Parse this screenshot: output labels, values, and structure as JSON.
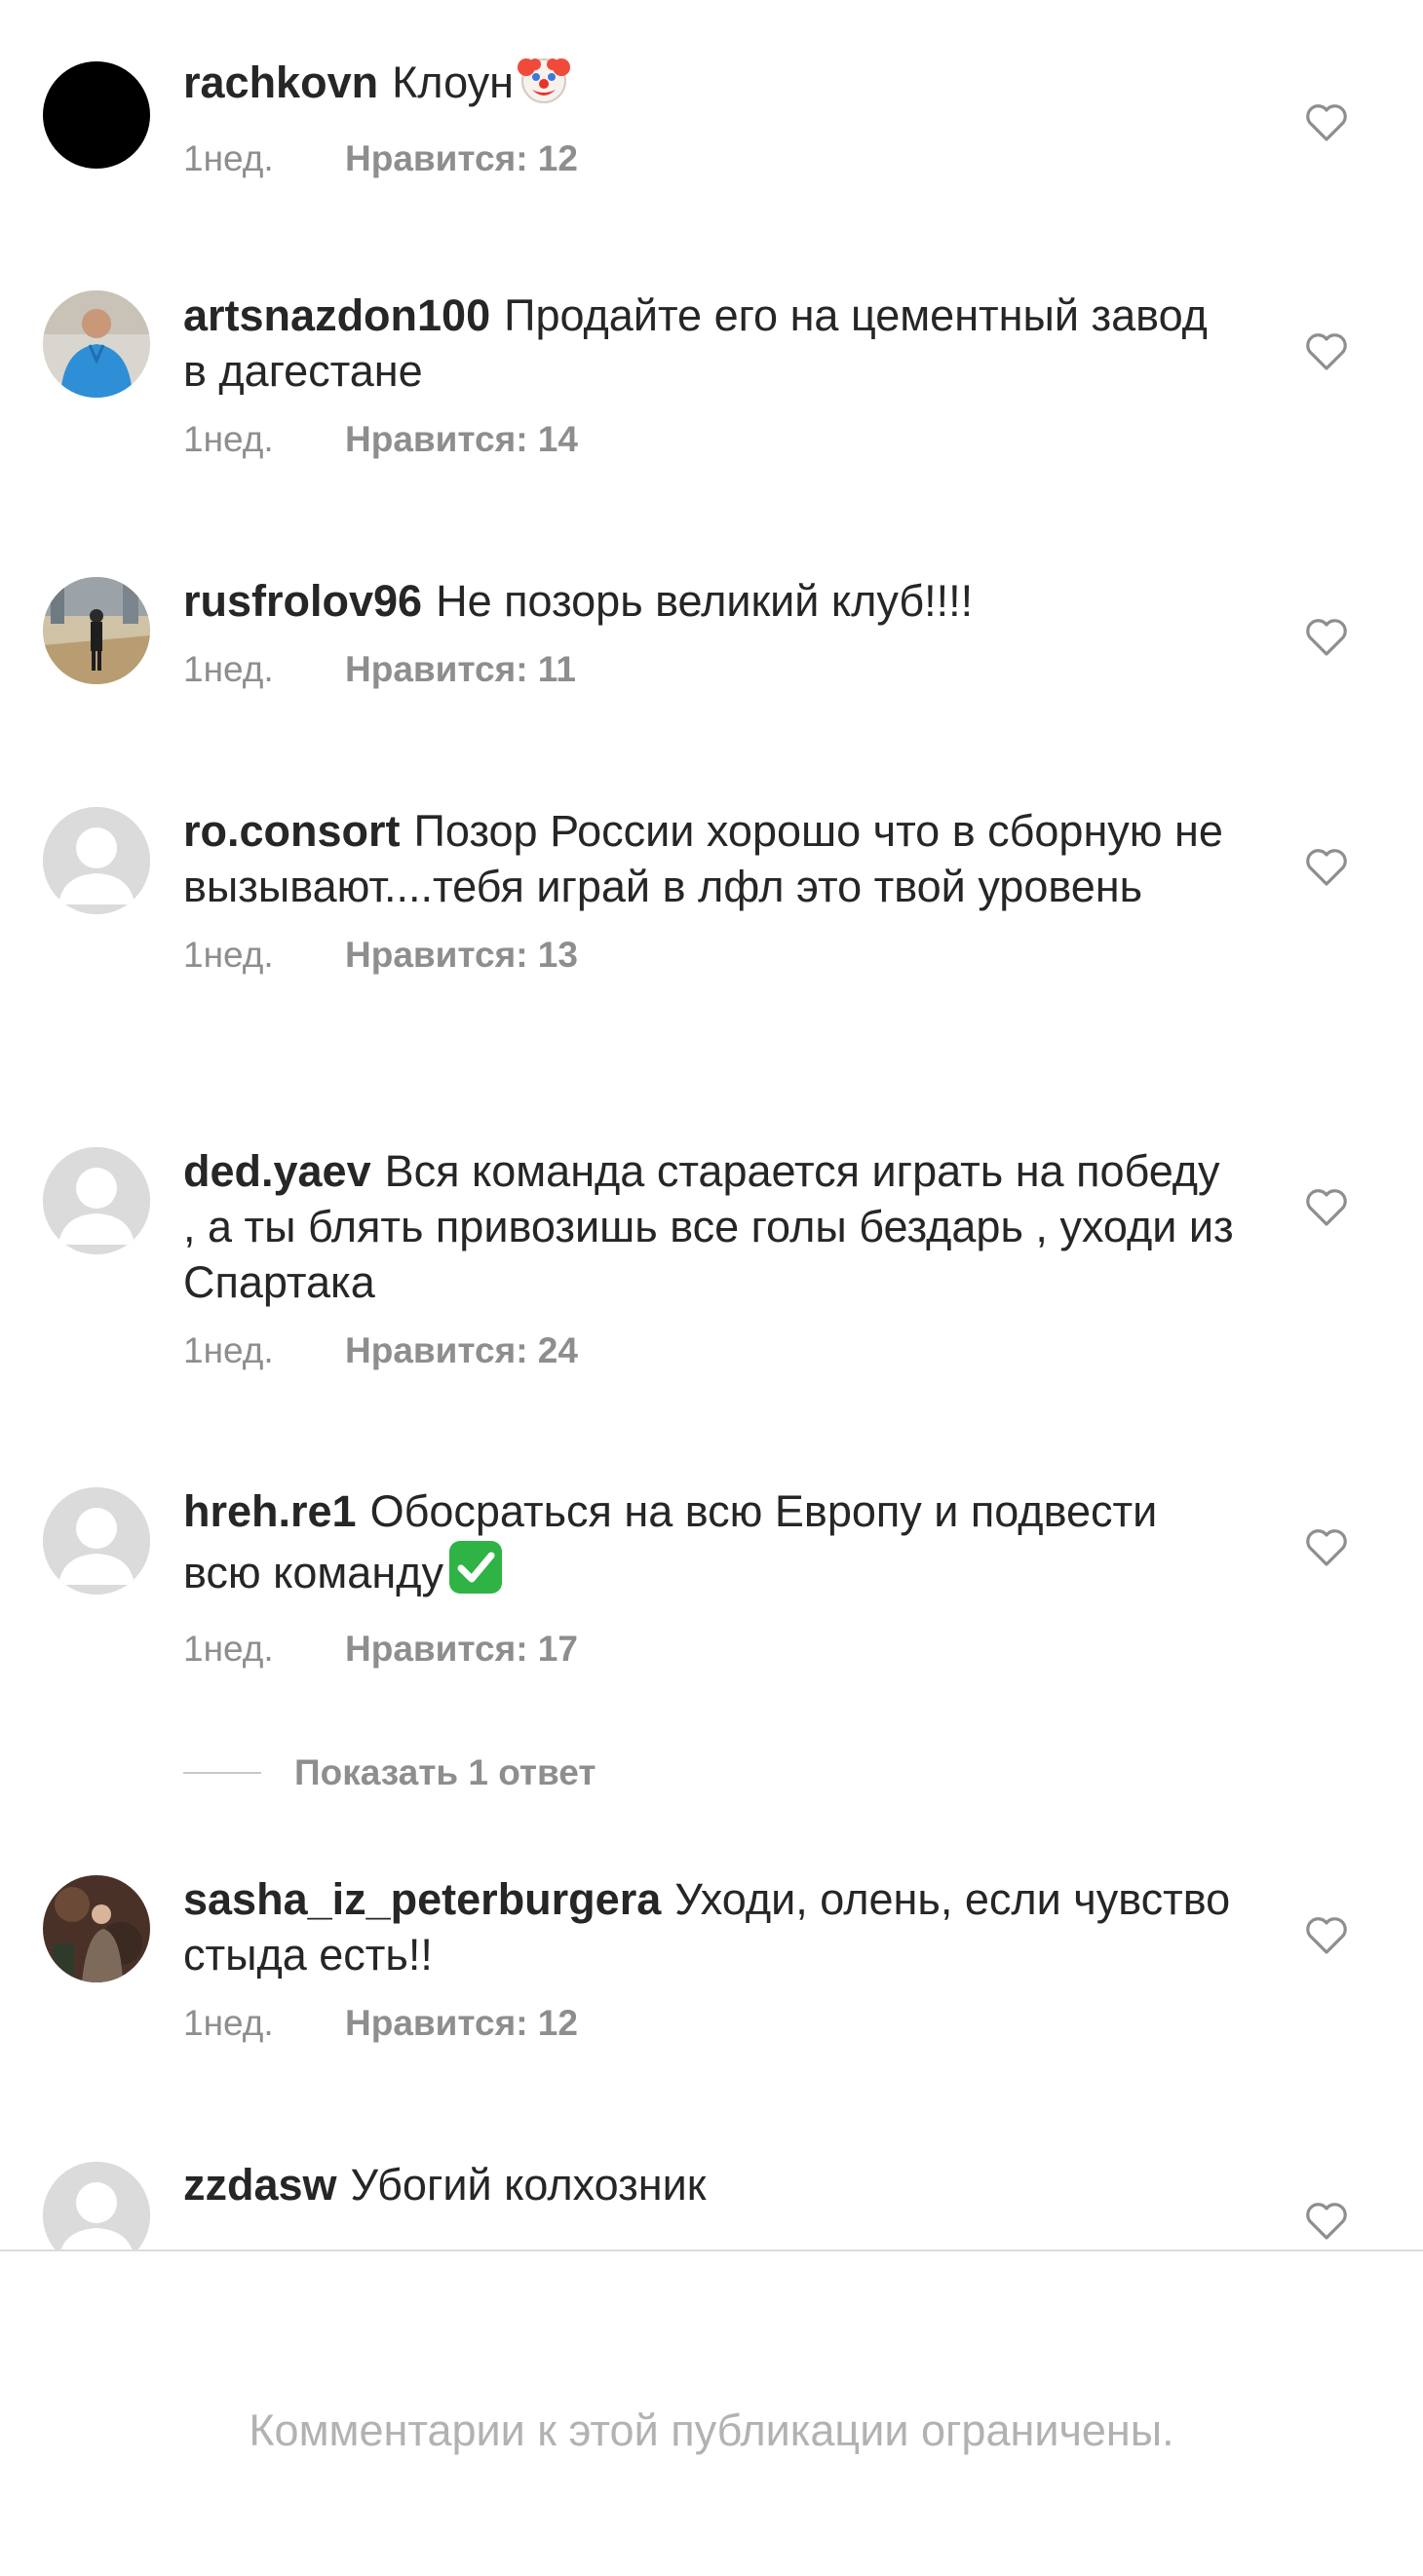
{
  "comments": [
    {
      "username": "rachkovn",
      "text": "Клоун",
      "emoji": "clown-face-emoji",
      "time": "1нед.",
      "likes": "Нравится: 12",
      "avatar": "black-avatar"
    },
    {
      "username": "artsnazdon100",
      "text": "Продайте его на цементный завод в дагестане",
      "time": "1нед.",
      "likes": "Нравится: 14",
      "avatar": "photo-avatar-blue-shirt"
    },
    {
      "username": "rusfrolov96",
      "text": "Не позорь великий клуб!!!!",
      "time": "1нед.",
      "likes": "Нравится: 11",
      "avatar": "photo-avatar-outdoor"
    },
    {
      "username": "ro.consort",
      "text": "Позор России хорошо что в сборную не вызывают....тебя играй в лфл это твой уровень",
      "time": "1нед.",
      "likes": "Нравится: 13",
      "avatar": "default-avatar"
    },
    {
      "username": "ded.yaev",
      "text": "Вся команда старается играть на победу , а ты блять привозишь все голы бездарь , уходи из Спартака",
      "time": "1нед.",
      "likes": "Нравится: 24",
      "avatar": "default-avatar"
    },
    {
      "username": "hreh.re1",
      "text": "Обосраться на всю Европу и подвести всю команду",
      "emoji": "check-mark-button-emoji",
      "time": "1нед.",
      "likes": "Нравится: 17",
      "avatar": "default-avatar"
    },
    {
      "username": "sasha_iz_peterburgera",
      "text": "Уходи, олень, если чувство стыда есть!!",
      "time": "1нед.",
      "likes": "Нравится: 12",
      "avatar": "photo-avatar-dark"
    },
    {
      "username": "zzdasw",
      "text": "Убогий колхозник",
      "avatar": "default-avatar"
    }
  ],
  "view_replies": "Показать 1 ответ",
  "restricted_notice": "Комментарии к этой публикации ограничены.",
  "colors": {
    "text": "#262626",
    "meta": "#8e8e8e",
    "notice": "#b2b2b2",
    "divider": "#dbdbdb",
    "avatar_placeholder": "#dbdbdb",
    "check_green": "#2fb344"
  }
}
